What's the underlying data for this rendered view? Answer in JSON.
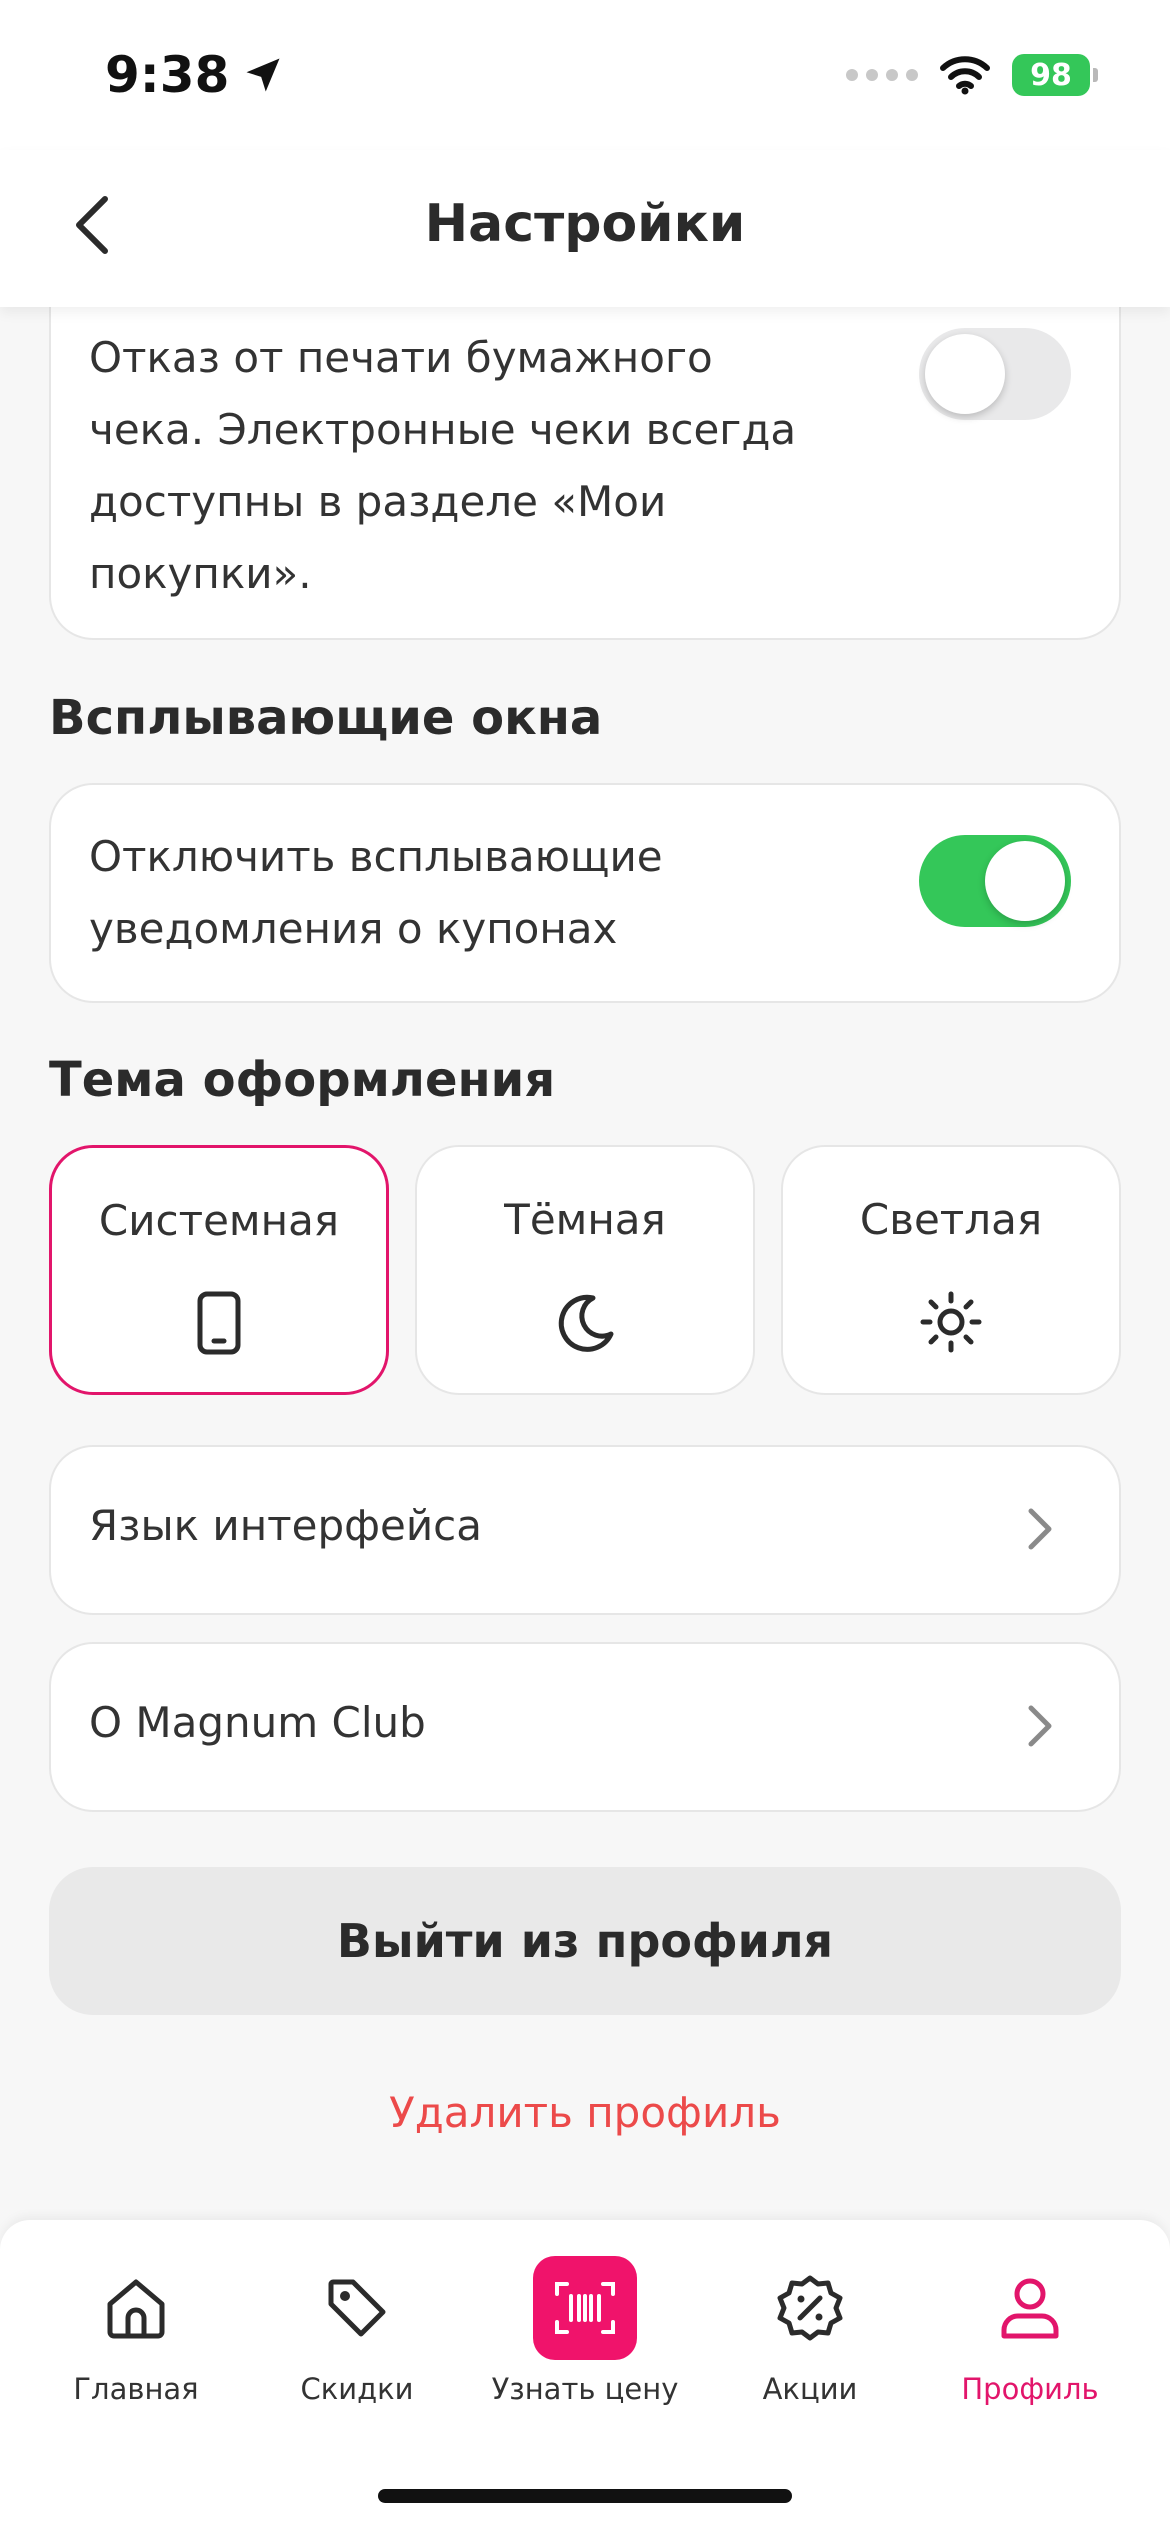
{
  "status_bar": {
    "time": "9:38",
    "battery": "98"
  },
  "header": {
    "title": "Настройки"
  },
  "receipt_card": {
    "lines": [
      "Отказ от печати бумажного",
      "чека. Электронные чеки всегда",
      "доступны в разделе «Мои",
      "покупки»."
    ],
    "toggle_on": false
  },
  "popups": {
    "title": "Всплывающие окна",
    "lines": [
      "Отключить всплывающие",
      "уведомления о купонах"
    ],
    "toggle_on": true
  },
  "theme": {
    "title": "Тема оформления",
    "options": [
      {
        "label": "Системная",
        "icon": "phone-icon",
        "selected": true
      },
      {
        "label": "Тёмная",
        "icon": "moon-icon",
        "selected": false
      },
      {
        "label": "Светлая",
        "icon": "sun-icon",
        "selected": false
      }
    ]
  },
  "rows": [
    {
      "label": "Язык интерфейса"
    },
    {
      "label": "О Magnum Club"
    }
  ],
  "logout_label": "Выйти из профиля",
  "delete_label": "Удалить профиль",
  "tabs": [
    {
      "label": "Главная",
      "icon": "home-icon"
    },
    {
      "label": "Скидки",
      "icon": "tag-icon"
    },
    {
      "label": "Узнать цену",
      "icon": "barcode-icon"
    },
    {
      "label": "Акции",
      "icon": "percent-badge-icon"
    },
    {
      "label": "Профиль",
      "icon": "user-icon",
      "active": true
    }
  ],
  "colors": {
    "accent": "#e2156b",
    "toggle_on": "#34c759",
    "danger": "#ec4a4a"
  }
}
